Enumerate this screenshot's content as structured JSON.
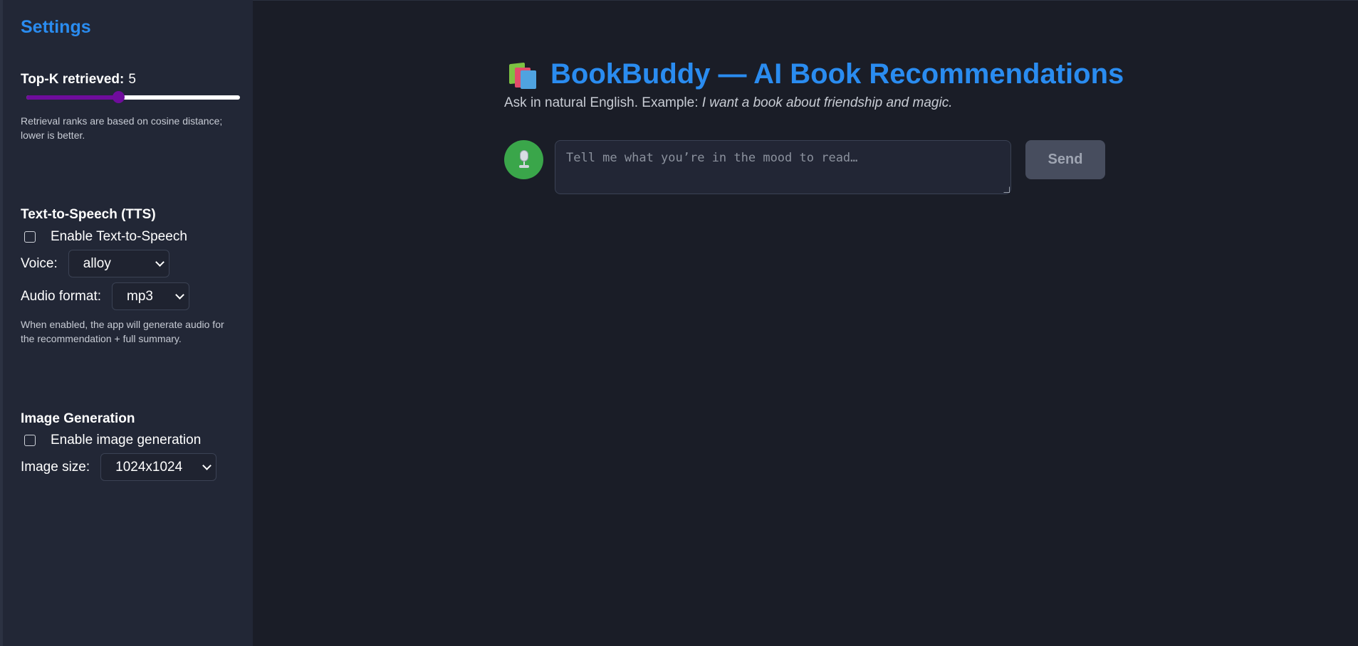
{
  "sidebar": {
    "title": "Settings",
    "retrieval": {
      "label": "Top-K retrieved:",
      "value": "5",
      "slider_fraction": 0.43,
      "help": "Retrieval ranks are based on cosine distance; lower is better."
    },
    "tts": {
      "title": "Text-to-Speech (TTS)",
      "enable_label": "Enable Text-to-Speech",
      "enabled": false,
      "voice_label": "Voice:",
      "voice_value": "alloy",
      "format_label": "Audio format:",
      "format_value": "mp3",
      "help": "When enabled, the app will generate audio for the recommendation + full summary."
    },
    "image": {
      "title": "Image Generation",
      "enable_label": "Enable image generation",
      "enabled": false,
      "size_label": "Image size:",
      "size_value": "1024x1024"
    }
  },
  "main": {
    "icon": "books-icon",
    "title": "BookBuddy — AI Book Recommendations",
    "subtitle_prefix": "Ask in natural English. Example: ",
    "subtitle_example": "I want a book about friendship and magic.",
    "input_placeholder": "Tell me what you’re in the mood to read…",
    "mic_icon": "microphone-icon",
    "send_label": "Send"
  },
  "colors": {
    "accent": "#2a8cf0",
    "slider": "#6f0c9c",
    "mic": "#3aa64a",
    "send_disabled": "#474d5e"
  }
}
